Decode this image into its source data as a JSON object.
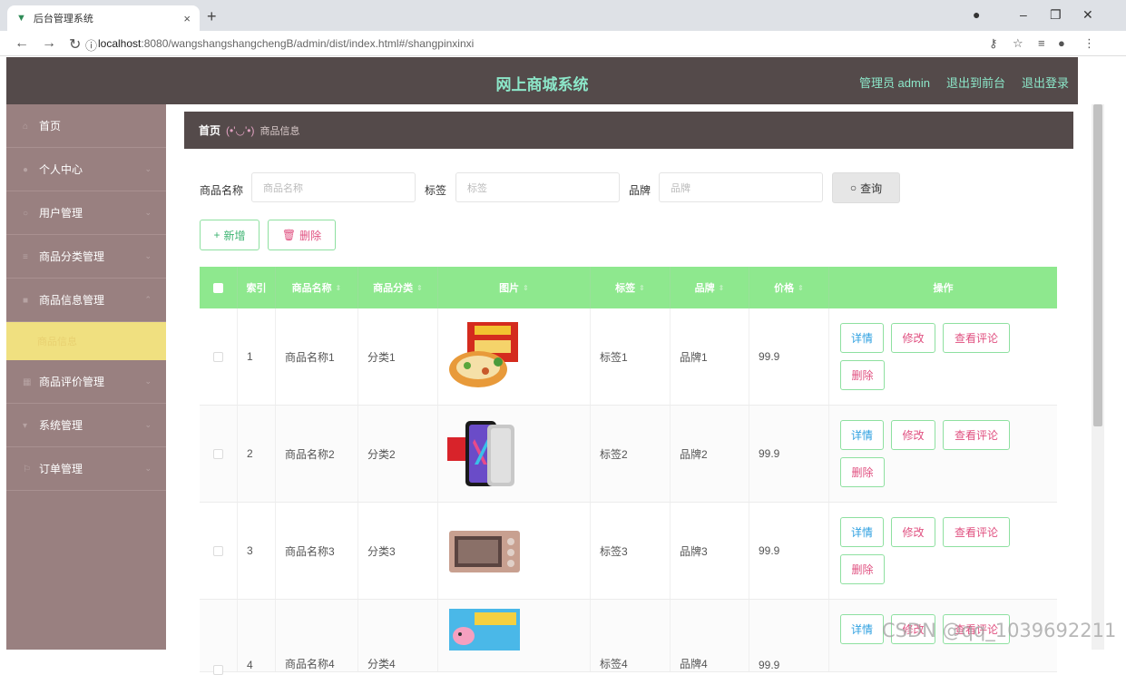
{
  "browser": {
    "tab_title": "后台管理系统",
    "url_host": "localhost",
    "url_rest": ":8080/wangshangshangchengB/admin/dist/index.html#/shangpinxinxi"
  },
  "header": {
    "title": "网上商城系统",
    "admin_label": "管理员 admin",
    "to_front": "退出到前台",
    "logout": "退出登录"
  },
  "sidebar": {
    "items": [
      {
        "label": "首页",
        "icon": "home-icon",
        "expandable": false
      },
      {
        "label": "个人中心",
        "icon": "user-icon",
        "expandable": true
      },
      {
        "label": "用户管理",
        "icon": "users-icon",
        "expandable": true
      },
      {
        "label": "商品分类管理",
        "icon": "list-icon",
        "expandable": true
      },
      {
        "label": "商品信息管理",
        "icon": "box-icon",
        "expandable": true
      }
    ],
    "active_sub": "商品信息",
    "items_after": [
      {
        "label": "商品评价管理",
        "icon": "grid-icon",
        "expandable": true
      },
      {
        "label": "系统管理",
        "icon": "settings-icon",
        "expandable": true
      },
      {
        "label": "订单管理",
        "icon": "order-icon",
        "expandable": true
      }
    ]
  },
  "breadcrumb": {
    "home": "首页",
    "separator": "(•'◡'•)",
    "current": "商品信息"
  },
  "search": {
    "name_label": "商品名称",
    "name_placeholder": "商品名称",
    "tag_label": "标签",
    "tag_placeholder": "标签",
    "brand_label": "品牌",
    "brand_placeholder": "品牌",
    "query_button": "查询"
  },
  "actions": {
    "add": "新增",
    "delete": "删除"
  },
  "table": {
    "columns": [
      "索引",
      "商品名称",
      "商品分类",
      "图片",
      "标签",
      "品牌",
      "价格",
      "操作"
    ],
    "rows": [
      {
        "index": "1",
        "name": "商品名称1",
        "category": "分类1",
        "tag": "标签1",
        "brand": "品牌1",
        "price": "99.9"
      },
      {
        "index": "2",
        "name": "商品名称2",
        "category": "分类2",
        "tag": "标签2",
        "brand": "品牌2",
        "price": "99.9"
      },
      {
        "index": "3",
        "name": "商品名称3",
        "category": "分类3",
        "tag": "标签3",
        "brand": "品牌3",
        "price": "99.9"
      },
      {
        "index": "4",
        "name": "商品名称4",
        "category": "分类4",
        "tag": "标签4",
        "brand": "品牌4",
        "price": "99.9"
      }
    ],
    "op_labels": {
      "detail": "详情",
      "edit": "修改",
      "review": "查看评论",
      "delete": "删除"
    }
  },
  "watermark": "CSDN @qq_1039692211",
  "colors": {
    "header_bg": "#544a4a",
    "accent_text": "#8ce7c9",
    "sidebar_bg": "#998080",
    "active_sub_bg": "#f0e080",
    "table_header_bg": "#8ee88e"
  }
}
